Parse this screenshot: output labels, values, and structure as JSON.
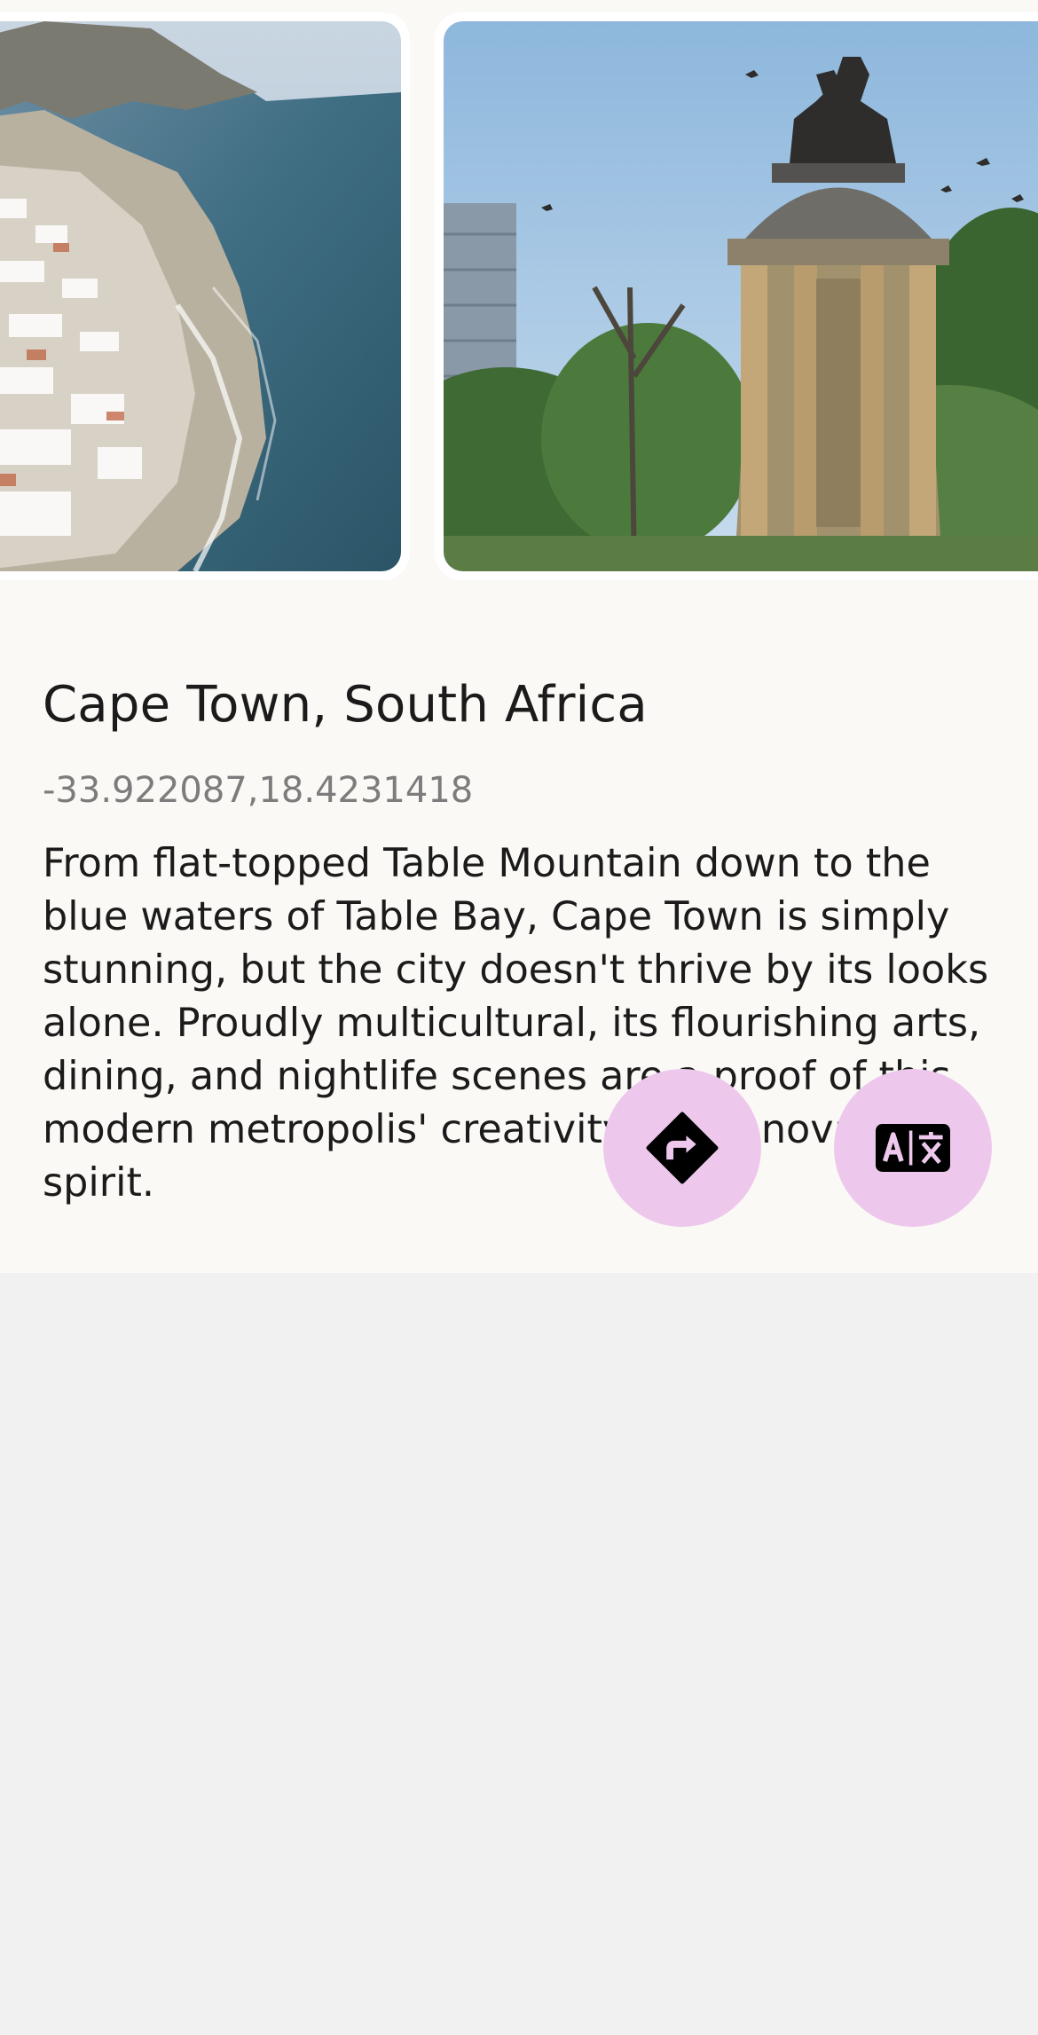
{
  "place": {
    "title": "Cape Town, South Africa",
    "coordinates": "-33.922087,18.4231418",
    "description": "From flat-topped Table Mountain down to the blue waters of Table Bay, Cape Town is simply stunning, but the city doesn't thrive by its looks alone. Proudly multicultural, its flourishing arts, dining, and nightlife scenes are a proof of this modern metropolis' creativity and innovative spirit."
  },
  "gallery": {
    "images": [
      {
        "subject": "aerial view of coastline with hillside buildings and ocean"
      },
      {
        "subject": "equestrian statue on a domed column monument among trees"
      }
    ]
  },
  "actions": [
    {
      "icon": "directions-icon"
    },
    {
      "icon": "translate-icon"
    }
  ],
  "colors": {
    "fab_background": "#edc8ec",
    "card_background": "#fbf9f6",
    "page_background": "#f2f1f1",
    "title_text": "#1b1b1b",
    "coords_text": "#7d7b7b"
  }
}
